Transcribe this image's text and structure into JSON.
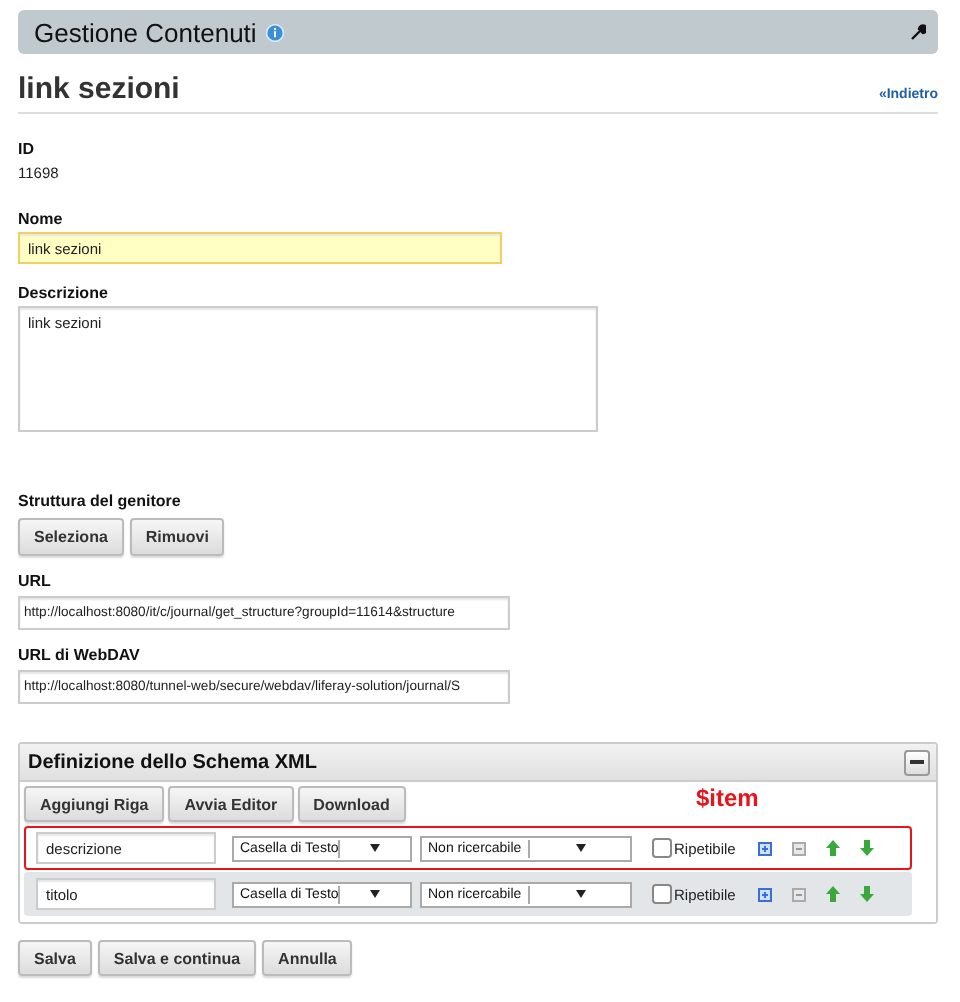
{
  "header": {
    "title": "Gestione Contenuti"
  },
  "page": {
    "title": "link sezioni",
    "back_link": "«Indietro"
  },
  "id_field": {
    "label": "ID",
    "value": "11698"
  },
  "name_field": {
    "label": "Nome",
    "value": "link sezioni",
    "focused": true
  },
  "description_field": {
    "label": "Descrizione",
    "value": "link sezioni"
  },
  "parent_structure": {
    "label": "Struttura del genitore",
    "buttons": [
      "Seleziona",
      "Rimuovi"
    ]
  },
  "url_field": {
    "label": "URL",
    "value": "http://localhost:8080/it/c/journal/get_structure?groupId=11614&structure"
  },
  "webdav_field": {
    "label": "URL di WebDAV",
    "value": "http://localhost:8080/tunnel-web/secure/webdav/liferay-solution/journal/S"
  },
  "schema": {
    "title": "Definizione dello Schema XML",
    "expanded": true,
    "buttons": [
      "Aggiungi Riga",
      "Avvia Editor",
      "Download"
    ],
    "annotation": "$item",
    "rows": [
      {
        "name": "descrizione",
        "type": "Casella di Testo",
        "indexing": "Non ricercabile",
        "repeatable_label": "Ripetibile",
        "repeatable": false,
        "highlighted": true
      },
      {
        "name": "titolo",
        "type": "Casella di Testo",
        "indexing": "Non ricercabile",
        "repeatable_label": "Ripetibile",
        "repeatable": false,
        "highlighted": false
      }
    ]
  },
  "buttons": [
    "Salva",
    "Salva e continua",
    "Annulla"
  ]
}
